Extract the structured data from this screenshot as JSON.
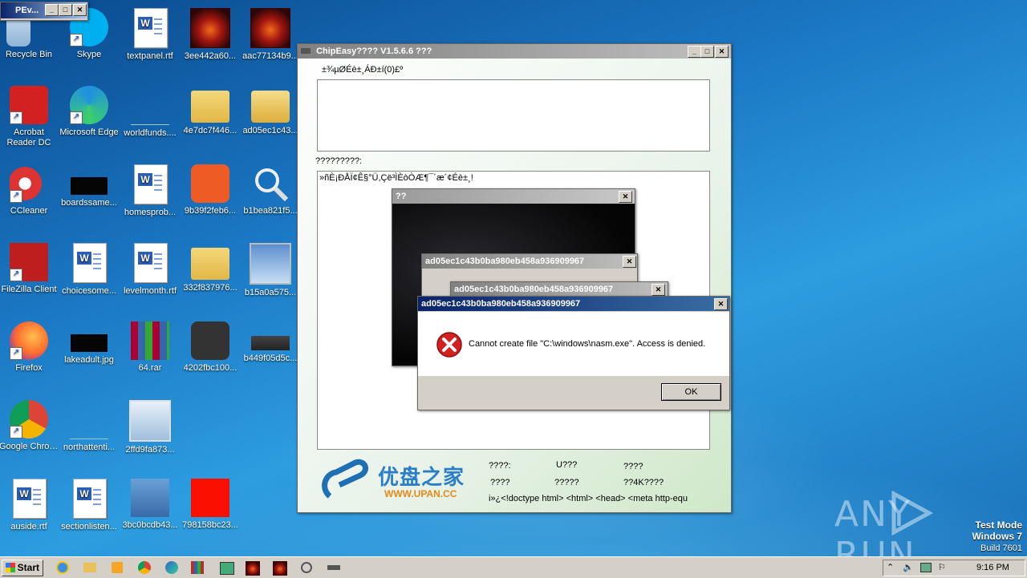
{
  "desktop": {
    "icons": [
      {
        "label": "Recycle Bin",
        "icon": "recycle-bin-icon"
      },
      {
        "label": "Skype",
        "icon": "skype-icon"
      },
      {
        "label": "textpanel.rtf",
        "icon": "word-document-icon"
      },
      {
        "label": "3ee442a60...",
        "icon": "horse-image-icon"
      },
      {
        "label": "aac77134b9...",
        "icon": "horse-image-icon"
      },
      {
        "label": "Acrobat Reader DC",
        "icon": "acrobat-icon"
      },
      {
        "label": "Microsoft Edge",
        "icon": "edge-icon"
      },
      {
        "label": "worldfunds....",
        "icon": "blank-file-icon"
      },
      {
        "label": "4e7dc7f446...",
        "icon": "folder-icon"
      },
      {
        "label": "ad05ec1c43...",
        "icon": "folder-icon"
      },
      {
        "label": "CCleaner",
        "icon": "ccleaner-icon"
      },
      {
        "label": "boardssame...",
        "icon": "black-image-icon"
      },
      {
        "label": "homesprob...",
        "icon": "word-document-icon"
      },
      {
        "label": "9b39f2feb6...",
        "icon": "sogou-icon"
      },
      {
        "label": "b1bea821f5...",
        "icon": "magnifier-icon"
      },
      {
        "label": "FileZilla Client",
        "icon": "filezilla-icon"
      },
      {
        "label": "choicesome...",
        "icon": "word-document-icon"
      },
      {
        "label": "levelmonth.rtf",
        "icon": "word-document-icon"
      },
      {
        "label": "332f837976...",
        "icon": "folder-icon"
      },
      {
        "label": "b15a0a575...",
        "icon": "setup-icon"
      },
      {
        "label": "Firefox",
        "icon": "firefox-icon"
      },
      {
        "label": "lakeadult.jpg",
        "icon": "black-image-icon"
      },
      {
        "label": "64.rar",
        "icon": "winrar-icon"
      },
      {
        "label": "4202fbc100...",
        "icon": "app-s-icon"
      },
      {
        "label": "b449f05d5c...",
        "icon": "chip-shield-icon"
      },
      {
        "label": "Google Chrome",
        "icon": "chrome-icon"
      },
      {
        "label": "northattenti...",
        "icon": "blank-file-icon"
      },
      {
        "label": "2ffd9fa873...",
        "icon": "picture-shield-icon"
      },
      {
        "label": "auside.rtf",
        "icon": "word-document-icon"
      },
      {
        "label": "sectionlisten...",
        "icon": "word-document-icon"
      },
      {
        "label": "3bc0bcdb43...",
        "icon": "installer-icon"
      },
      {
        "label": "798158bc23...",
        "icon": "adobe-icon"
      }
    ]
  },
  "pe_window": {
    "title": "PEv..."
  },
  "chipeasy": {
    "title": "ChipEasy???? V1.5.6.6 ???",
    "label1": "±¾µØÉè±¸ÁÐ±í(0)£º",
    "label2": "?????????:",
    "text_line": "»ñÈ¡ÐÅÏ¢Ê§°Ü,Çë³ÌÈòÒÆ¶¯´æ´¢Éè±¸!",
    "logo_cn": "优盘之家",
    "logo_url": "WWW.UPAN.CC",
    "info": [
      "????:",
      "U???",
      "????",
      "????",
      "?????",
      "??4K????"
    ],
    "marquee": "i»¿<!doctype html> <html> <head> <meta http-equ"
  },
  "inner_window": {
    "title": "??"
  },
  "error_back1": {
    "title": "ad05ec1c43b0ba980eb458a936909967"
  },
  "error_back2": {
    "title": "ad05ec1c43b0ba980eb458a936909967"
  },
  "error_dialog": {
    "title": "ad05ec1c43b0ba980eb458a936909967",
    "message": "Cannot create file \"C:\\windows\\nasm.exe\". Access is denied.",
    "ok_label": "OK"
  },
  "watermark": {
    "brand": "ANY RUN",
    "mode": "Test Mode",
    "os": "Windows 7",
    "build": "Build 7601"
  },
  "taskbar": {
    "start_label": "Start",
    "clock": "9:16 PM"
  }
}
